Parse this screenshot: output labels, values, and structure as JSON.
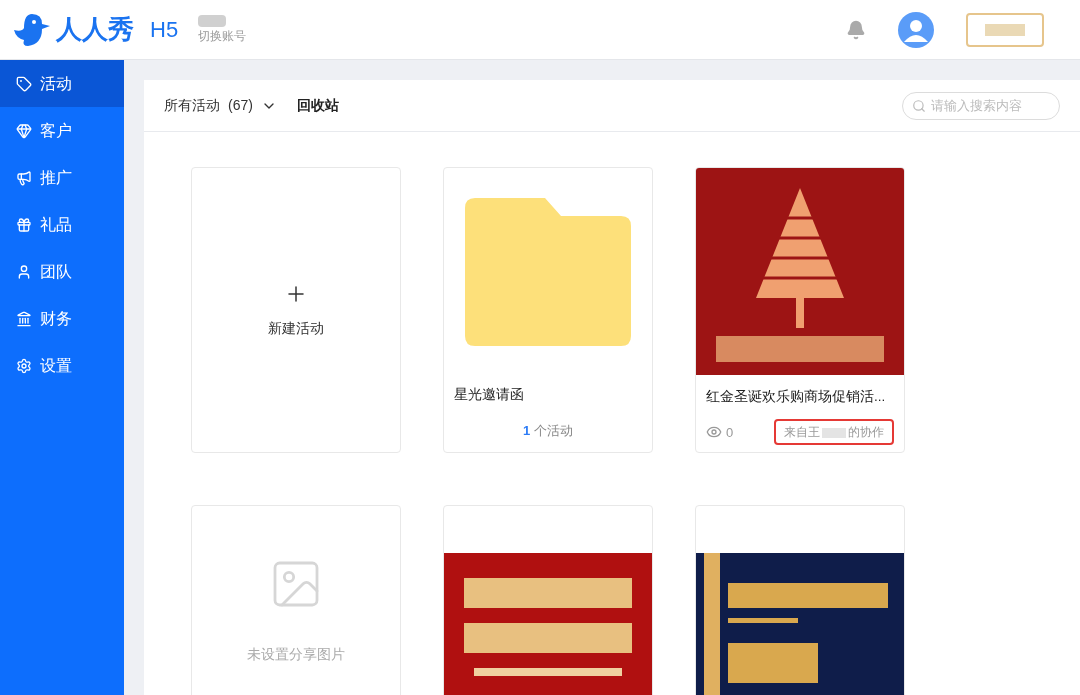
{
  "header": {
    "brand": "人人秀",
    "product": "H5",
    "switch_account": "切换账号"
  },
  "sidebar": {
    "items": [
      {
        "label": "活动",
        "selected": true
      },
      {
        "label": "客户",
        "selected": false
      },
      {
        "label": "推广",
        "selected": false
      },
      {
        "label": "礼品",
        "selected": false
      },
      {
        "label": "团队",
        "selected": false
      },
      {
        "label": "财务",
        "selected": false
      },
      {
        "label": "设置",
        "selected": false
      }
    ]
  },
  "toolbar": {
    "filter": "所有活动",
    "count": "(67)",
    "recycle": "回收站",
    "search": {
      "placeholder": "请输入搜索内容"
    }
  },
  "cards": [
    {
      "kind": "new",
      "label": "新建活动"
    },
    {
      "kind": "folder",
      "title": "星光邀请函",
      "count": "1",
      "count_label": "个活动"
    },
    {
      "kind": "event",
      "title": "红金圣诞欢乐购商场促销活...",
      "views": "0",
      "collab_prefix": "来自王",
      "collab_suffix": "的协作"
    },
    {
      "kind": "noimage",
      "label": "未设置分享图片"
    },
    {
      "kind": "poster"
    },
    {
      "kind": "poster"
    }
  ]
}
